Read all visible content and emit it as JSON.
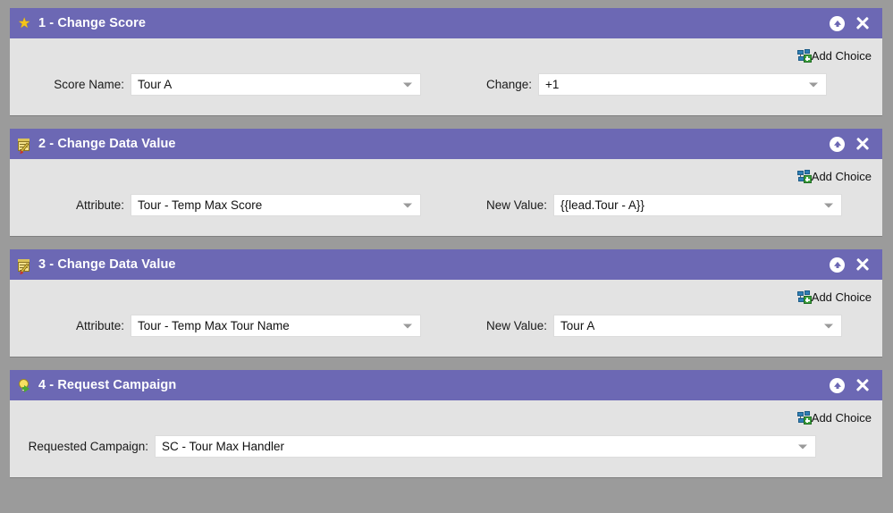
{
  "theme": {
    "header_purple": "#6c68b4",
    "panel_bg": "#e3e3e3",
    "page_bg": "#9b9b9b",
    "field_bg": "#ffffff",
    "spellcheck_red": "#e8503a",
    "star_yellow": "#f5c518"
  },
  "common": {
    "add_choice_label": "Add Choice",
    "move_up_title": "Move Up",
    "delete_title": "Delete"
  },
  "steps": [
    {
      "icon": "star-icon",
      "title": "1 - Change Score",
      "add_choice_label": "Add Choice",
      "fields": [
        {
          "label": "Score Name:",
          "value": "Tour A",
          "spellcheck_error": true
        },
        {
          "label": "Change:",
          "value": "+1",
          "spellcheck_error": false
        }
      ]
    },
    {
      "icon": "form-edit-icon",
      "title": "2 - Change Data Value",
      "add_choice_label": "Add Choice",
      "fields": [
        {
          "label": "Attribute:",
          "value": "Tour - Temp Max Score",
          "spellcheck_error": false
        },
        {
          "label": "New Value:",
          "value": "{{lead.Tour - A}}",
          "spellcheck_error": true
        }
      ]
    },
    {
      "icon": "form-edit-icon",
      "title": "3 - Change Data Value",
      "add_choice_label": "Add Choice",
      "fields": [
        {
          "label": "Attribute:",
          "value": "Tour - Temp Max Tour Name",
          "spellcheck_error": false
        },
        {
          "label": "New Value:",
          "value": "Tour A",
          "spellcheck_error": false
        }
      ]
    },
    {
      "icon": "lightbulb-icon",
      "title": "4 - Request Campaign",
      "add_choice_label": "Add Choice",
      "fields": [
        {
          "label": "Requested Campaign:",
          "value": "SC - Tour Max Handler",
          "spellcheck_error": false
        }
      ]
    }
  ]
}
